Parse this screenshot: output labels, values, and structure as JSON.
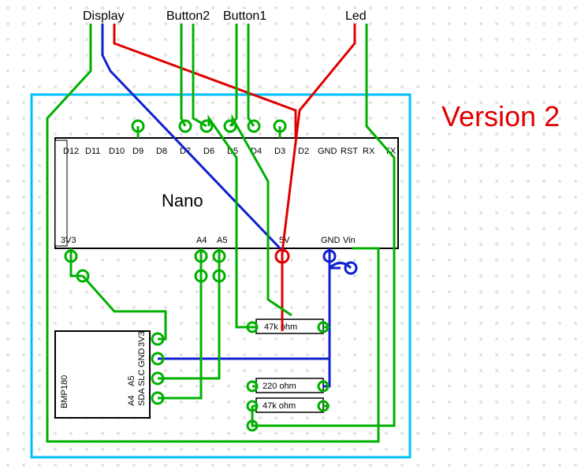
{
  "title": "Version 2",
  "top_labels": {
    "display": "Display",
    "button2": "Button2",
    "button1": "Button1",
    "led": "Led"
  },
  "board": {
    "name": "Nano",
    "top_pins": [
      "D12",
      "D11",
      "D10",
      "D9",
      "D8",
      "D7",
      "D6",
      "D5",
      "D4",
      "D3",
      "D2",
      "GND",
      "RST",
      "RX",
      "TX"
    ],
    "bottom_pins": [
      "3V3",
      "",
      "",
      "",
      "",
      "",
      "",
      "A4",
      "A5",
      "",
      "",
      "5V",
      "",
      "GND",
      "Vin"
    ]
  },
  "module": {
    "name": "BMP180",
    "pins": [
      "3V3",
      "GND",
      "SLC",
      "SDA"
    ],
    "pin_aliases": [
      "",
      "",
      "A5",
      "A4"
    ]
  },
  "resistors": {
    "r1": "47k ohm",
    "r2": "220 ohm",
    "r3": "47k ohm"
  },
  "wire_colors": {
    "green": "#00b000",
    "blue": "#1020d0",
    "red": "#e00000"
  }
}
